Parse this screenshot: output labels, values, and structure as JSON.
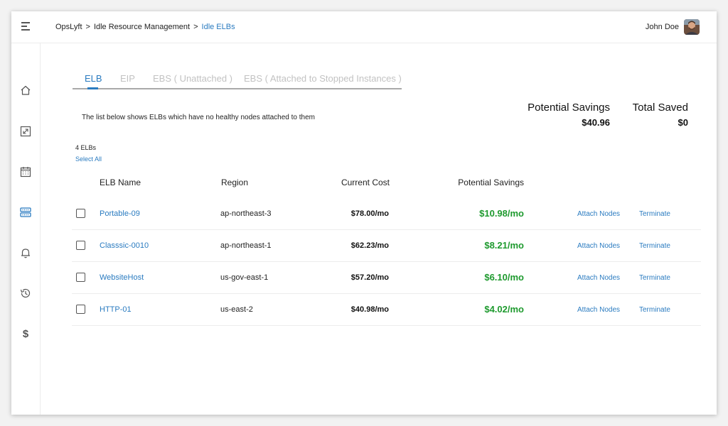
{
  "breadcrumb": {
    "items": [
      "OpsLyft",
      "Idle Resource Management"
    ],
    "separator": ">",
    "current": "Idle ELBs"
  },
  "user": {
    "name": "John Doe"
  },
  "sidebar": {
    "icons": [
      "home-icon",
      "resize-icon",
      "calendar-icon",
      "server-icon",
      "bell-icon",
      "history-icon",
      "dollar-icon"
    ],
    "active": "server-icon"
  },
  "tabs": [
    {
      "label": "ELB",
      "active": true
    },
    {
      "label": "EIP",
      "active": false
    },
    {
      "label": "EBS ( Unattached )",
      "active": false
    },
    {
      "label": "EBS ( Attached to Stopped Instances )",
      "active": false
    }
  ],
  "description": "The list below shows ELBs which have no healthy nodes attached to them",
  "summary": {
    "potential_savings_label": "Potential Savings",
    "potential_savings_value": "$40.96",
    "total_saved_label": "Total Saved",
    "total_saved_value": "$0"
  },
  "list": {
    "count": "4 ELBs",
    "select_all": "Select All"
  },
  "table": {
    "headers": [
      "ELB Name",
      "Region",
      "Current Cost",
      "Potential Savings"
    ],
    "rows": [
      {
        "name": "Portable-09",
        "region": "ap-northeast-3",
        "cost": "$78.00/mo",
        "savings": "$10.98/mo",
        "attach": "Attach Nodes",
        "terminate": "Terminate"
      },
      {
        "name": "Classsic-0010",
        "region": "ap-northeast-1",
        "cost": "$62.23/mo",
        "savings": "$8.21/mo",
        "attach": "Attach Nodes",
        "terminate": "Terminate"
      },
      {
        "name": "WebsiteHost",
        "region": "us-gov-east-1",
        "cost": "$57.20/mo",
        "savings": "$6.10/mo",
        "attach": "Attach Nodes",
        "terminate": "Terminate"
      },
      {
        "name": "HTTP-01",
        "region": "us-east-2",
        "cost": "$40.98/mo",
        "savings": "$4.02/mo",
        "attach": "Attach Nodes",
        "terminate": "Terminate"
      }
    ]
  },
  "colors": {
    "accent": "#2a7bc0",
    "savings": "#1e9a2e",
    "inactive_tab": "#c2c2c2"
  }
}
